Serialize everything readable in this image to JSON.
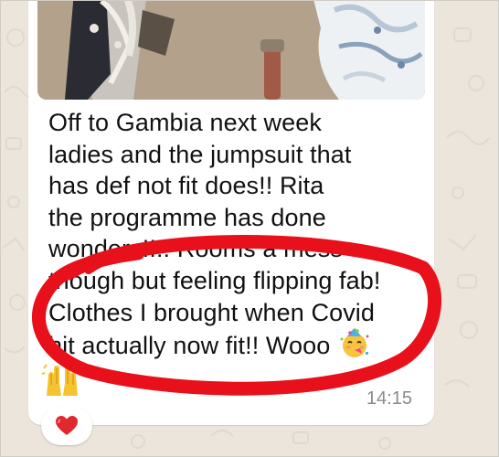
{
  "message": {
    "lines": [
      "Off to Gambia next week",
      "ladies and the jumpsuit that",
      "has def not fit does!! Rita",
      "the programme has done",
      "wonders!!!! Rooms a mess",
      "though but feeling flipping fab!",
      "Clothes I brought when Covid",
      "hit actually now fit!! Wooo"
    ],
    "timestamp": "14:15"
  },
  "icons": {
    "party_emoji": "partying-face-emoji",
    "hands_emoji": "raising-hands-emoji",
    "reaction": "red-heart-reaction"
  },
  "colors": {
    "chat_background": "#ece5dc",
    "bubble": "#ffffff",
    "annotation_ellipse": "#e8101a",
    "heart": "#e0282e",
    "timestamp": "#8a8a8a"
  }
}
